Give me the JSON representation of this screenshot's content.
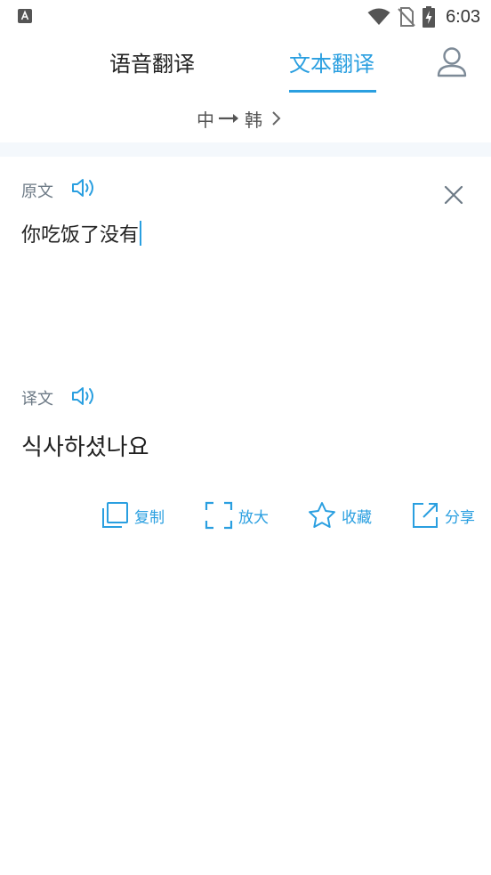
{
  "status_bar": {
    "time": "6:03",
    "left_icon": "a-notification-icon",
    "icons": [
      "wifi-icon",
      "no-sim-icon",
      "battery-charging-icon"
    ]
  },
  "tabs": [
    {
      "label": "语音翻译",
      "active": false
    },
    {
      "label": "文本翻译",
      "active": true
    }
  ],
  "language": {
    "from": "中",
    "to": "韩"
  },
  "source": {
    "label": "原文",
    "text": "你吃饭了没有"
  },
  "target": {
    "label": "译文",
    "text": "식사하셨나요"
  },
  "actions": [
    {
      "label": "复制",
      "icon": "copy-icon"
    },
    {
      "label": "放大",
      "icon": "fullscreen-icon"
    },
    {
      "label": "收藏",
      "icon": "star-icon"
    },
    {
      "label": "分享",
      "icon": "share-icon"
    }
  ],
  "colors": {
    "accent": "#2a9fe0",
    "text": "#222222",
    "label": "#6d7a86"
  }
}
